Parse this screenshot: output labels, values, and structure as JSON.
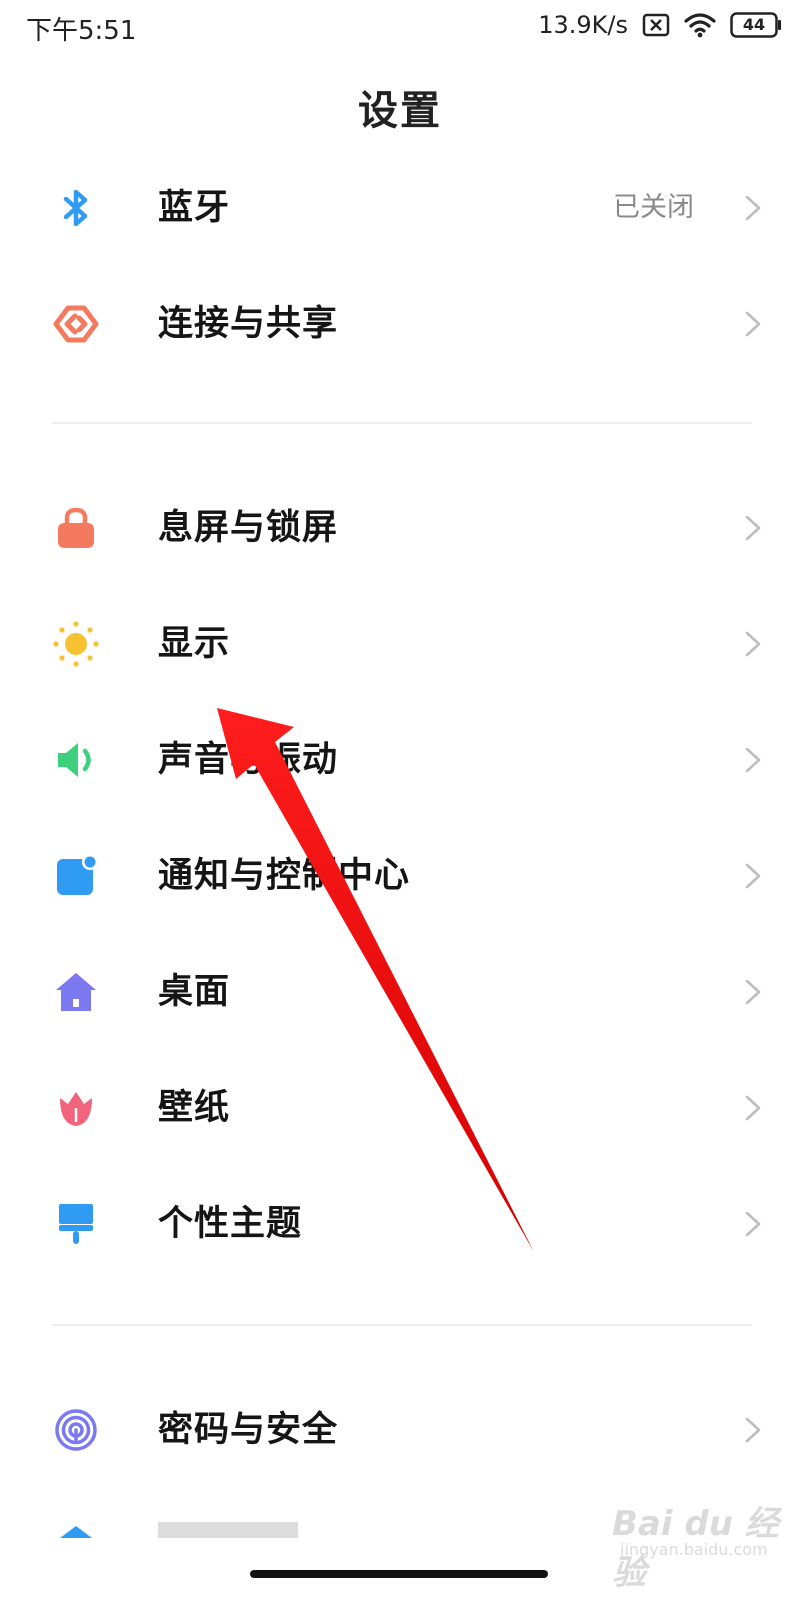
{
  "status_bar": {
    "time": "下午5:51",
    "net_speed": "13.9K/s",
    "battery_level": "44",
    "icons": [
      "sim-disabled-icon",
      "wifi-icon",
      "battery-icon"
    ]
  },
  "page": {
    "title": "设置"
  },
  "sections": [
    {
      "items": [
        {
          "label": "蓝牙",
          "value": "已关闭",
          "icon": "bluetooth-icon",
          "color": "#2f9bf2"
        },
        {
          "label": "连接与共享",
          "value": "",
          "icon": "connection-sharing-icon",
          "color": "#f47a5f"
        }
      ]
    },
    {
      "items": [
        {
          "label": "息屏与锁屏",
          "value": "",
          "icon": "lock-icon",
          "color": "#f47a5f"
        },
        {
          "label": "显示",
          "value": "",
          "icon": "sun-icon",
          "color": "#f7c231"
        },
        {
          "label": "声音与振动",
          "value": "",
          "icon": "speaker-icon",
          "color": "#3ed07c"
        },
        {
          "label": "通知与控制中心",
          "value": "",
          "icon": "notification-icon",
          "color": "#2f9bf2"
        },
        {
          "label": "桌面",
          "value": "",
          "icon": "home-icon",
          "color": "#7b78f0"
        },
        {
          "label": "壁纸",
          "value": "",
          "icon": "flower-icon",
          "color": "#f1657c"
        },
        {
          "label": "个性主题",
          "value": "",
          "icon": "paint-brush-icon",
          "color": "#2f9bf2"
        }
      ]
    },
    {
      "items": [
        {
          "label": "密码与安全",
          "value": "",
          "icon": "fingerprint-icon",
          "color": "#7b78f0"
        }
      ]
    }
  ],
  "watermark": {
    "brand": "Bai du 经验",
    "url": "jingyan.baidu.com"
  }
}
